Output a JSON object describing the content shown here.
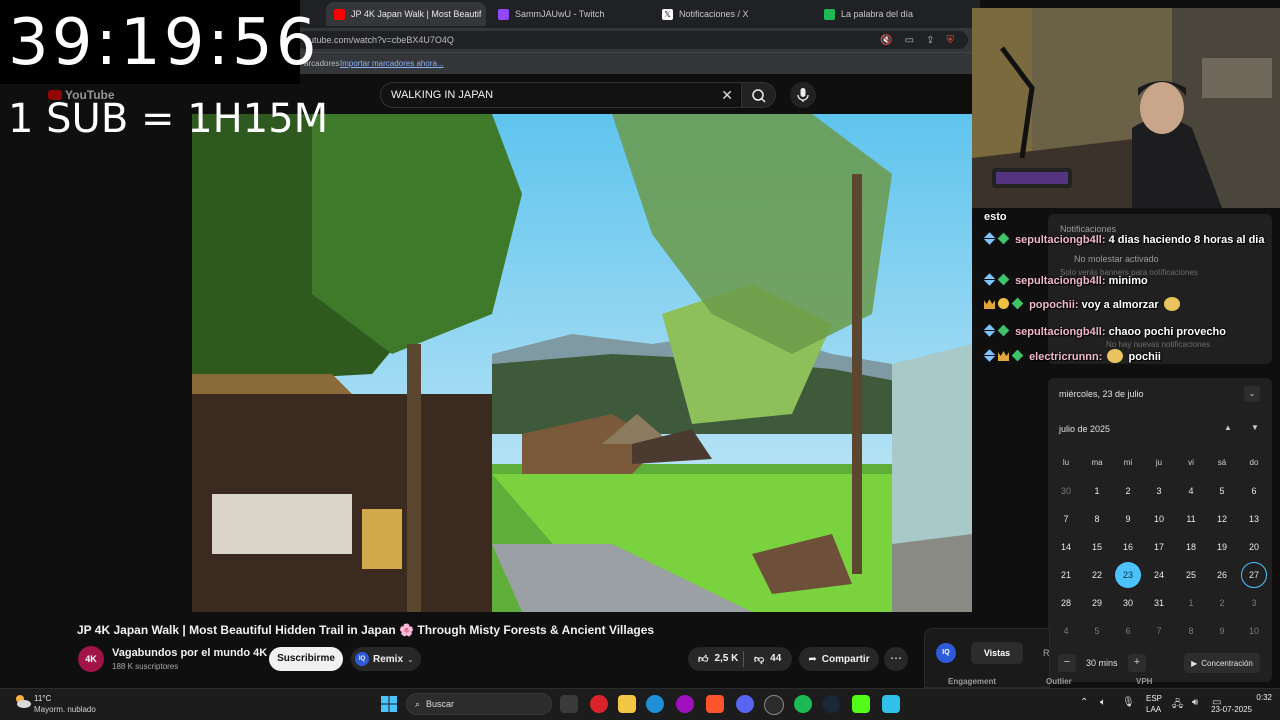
{
  "overlay": {
    "timer": "39:19:56",
    "sub_rule": "1 SUB = 1H15M"
  },
  "browser": {
    "tabs": [
      {
        "label": "JP 4K Japan Walk | Most Beautif",
        "active": true,
        "color": "#ff0000"
      },
      {
        "label": "SammJAUwU - Twitch",
        "active": false,
        "color": "#9146ff"
      },
      {
        "label": "Notificaciones / X",
        "active": false,
        "color": "#ffffff"
      },
      {
        "label": "La palabra del día",
        "active": false,
        "color": "#1db954"
      }
    ],
    "url": "outube.com/watch?v=cbeBX4U7O4Q",
    "bookmarks_text": "arcadores",
    "bookmarks_import": "Importar marcadores ahora..."
  },
  "youtube": {
    "logo": "YouTube",
    "search_value": "WALKING IN JAPAN",
    "video_title": "JP 4K Japan Walk | Most Beautiful Hidden Trail in Japan 🌸 Through Misty Forests & Ancient Villages",
    "channel_avatar": "4K",
    "channel_name": "Vagabundos por el mundo 4K",
    "subscribers": "188 K suscriptores",
    "subscribe_label": "Suscribirme",
    "remix_label": "Remix",
    "likes": "2,5 K",
    "dislikes": "44",
    "share_label": "Compartir",
    "more_label": "⋯"
  },
  "extension": {
    "logo": "IQ",
    "tab_active": "Vistas",
    "tab_next": "R",
    "subs": [
      "Engagement",
      "Outlier",
      "VPH"
    ]
  },
  "chat": [
    {
      "user": "",
      "message": "esto",
      "badges": []
    },
    {
      "user": "sepultaciongb4ll:",
      "message": "4 dias haciendo 8 horas al dia",
      "badges": [
        "sword",
        "gem"
      ]
    },
    {
      "user": "sepultaciongb4ll:",
      "message": "minimo",
      "badges": [
        "sword",
        "gem"
      ]
    },
    {
      "user": "popochii:",
      "message": "voy a almorzar",
      "badges": [
        "crown",
        "coin",
        "gem"
      ]
    },
    {
      "user": "sepultaciongb4ll:",
      "message": "chaoo pochi provecho",
      "badges": [
        "sword",
        "gem"
      ]
    },
    {
      "user": "electricrunnn:",
      "message": "pochii",
      "badges": [
        "sword",
        "crown",
        "gem"
      ]
    }
  ],
  "notifications": {
    "title": "Notificaciones",
    "dnd": "No molestar activado",
    "banners": "Solo verás banners para notificaciones",
    "none": "No hay nuevas notificaciones"
  },
  "calendar": {
    "selected_date": "miércoles, 23 de julio",
    "month": "julio de 2025",
    "weekdays": [
      "lu",
      "ma",
      "mi",
      "ju",
      "vi",
      "sá",
      "do"
    ],
    "weeks": [
      [
        "30",
        "1",
        "2",
        "3",
        "4",
        "5",
        "6"
      ],
      [
        "7",
        "8",
        "9",
        "10",
        "11",
        "12",
        "13"
      ],
      [
        "14",
        "15",
        "16",
        "17",
        "18",
        "19",
        "20"
      ],
      [
        "21",
        "22",
        "23",
        "24",
        "25",
        "26",
        "27"
      ],
      [
        "28",
        "29",
        "30",
        "31",
        "1",
        "2",
        "3"
      ],
      [
        "4",
        "5",
        "6",
        "7",
        "8",
        "9",
        "10"
      ]
    ],
    "today": "23",
    "focus_minus": "−",
    "focus_minutes": "30 mins",
    "focus_plus": "+",
    "focus_button": "Concentración"
  },
  "taskbar": {
    "temperature": "11°C",
    "weather": "Mayorm. nublado",
    "search_label": "Buscar",
    "lang1": "ESP",
    "lang2": "LAA",
    "time": "0:32",
    "date": "23-07-2025"
  }
}
